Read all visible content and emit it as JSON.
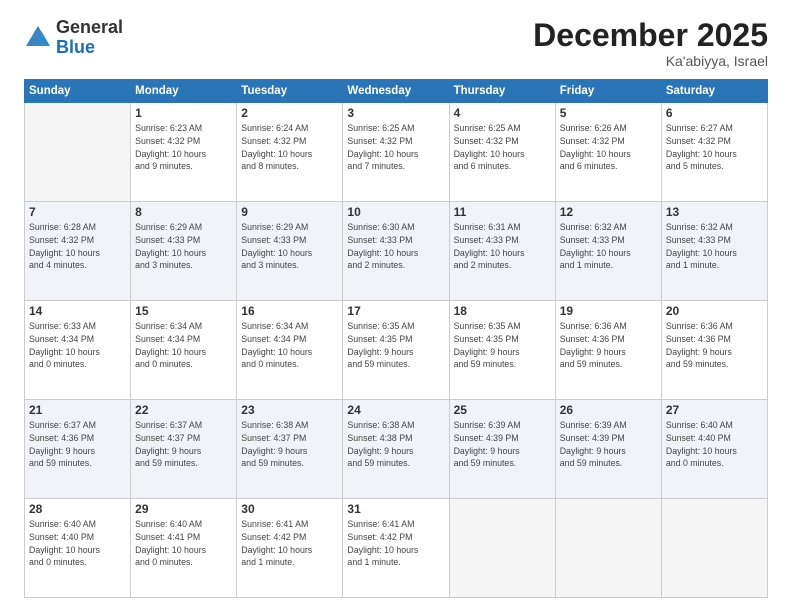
{
  "header": {
    "logo_general": "General",
    "logo_blue": "Blue",
    "month": "December 2025",
    "location": "Ka'abiyya, Israel"
  },
  "days_of_week": [
    "Sunday",
    "Monday",
    "Tuesday",
    "Wednesday",
    "Thursday",
    "Friday",
    "Saturday"
  ],
  "weeks": [
    [
      {
        "num": "",
        "info": ""
      },
      {
        "num": "1",
        "info": "Sunrise: 6:23 AM\nSunset: 4:32 PM\nDaylight: 10 hours\nand 9 minutes."
      },
      {
        "num": "2",
        "info": "Sunrise: 6:24 AM\nSunset: 4:32 PM\nDaylight: 10 hours\nand 8 minutes."
      },
      {
        "num": "3",
        "info": "Sunrise: 6:25 AM\nSunset: 4:32 PM\nDaylight: 10 hours\nand 7 minutes."
      },
      {
        "num": "4",
        "info": "Sunrise: 6:25 AM\nSunset: 4:32 PM\nDaylight: 10 hours\nand 6 minutes."
      },
      {
        "num": "5",
        "info": "Sunrise: 6:26 AM\nSunset: 4:32 PM\nDaylight: 10 hours\nand 6 minutes."
      },
      {
        "num": "6",
        "info": "Sunrise: 6:27 AM\nSunset: 4:32 PM\nDaylight: 10 hours\nand 5 minutes."
      }
    ],
    [
      {
        "num": "7",
        "info": "Sunrise: 6:28 AM\nSunset: 4:32 PM\nDaylight: 10 hours\nand 4 minutes."
      },
      {
        "num": "8",
        "info": "Sunrise: 6:29 AM\nSunset: 4:33 PM\nDaylight: 10 hours\nand 3 minutes."
      },
      {
        "num": "9",
        "info": "Sunrise: 6:29 AM\nSunset: 4:33 PM\nDaylight: 10 hours\nand 3 minutes."
      },
      {
        "num": "10",
        "info": "Sunrise: 6:30 AM\nSunset: 4:33 PM\nDaylight: 10 hours\nand 2 minutes."
      },
      {
        "num": "11",
        "info": "Sunrise: 6:31 AM\nSunset: 4:33 PM\nDaylight: 10 hours\nand 2 minutes."
      },
      {
        "num": "12",
        "info": "Sunrise: 6:32 AM\nSunset: 4:33 PM\nDaylight: 10 hours\nand 1 minute."
      },
      {
        "num": "13",
        "info": "Sunrise: 6:32 AM\nSunset: 4:33 PM\nDaylight: 10 hours\nand 1 minute."
      }
    ],
    [
      {
        "num": "14",
        "info": "Sunrise: 6:33 AM\nSunset: 4:34 PM\nDaylight: 10 hours\nand 0 minutes."
      },
      {
        "num": "15",
        "info": "Sunrise: 6:34 AM\nSunset: 4:34 PM\nDaylight: 10 hours\nand 0 minutes."
      },
      {
        "num": "16",
        "info": "Sunrise: 6:34 AM\nSunset: 4:34 PM\nDaylight: 10 hours\nand 0 minutes."
      },
      {
        "num": "17",
        "info": "Sunrise: 6:35 AM\nSunset: 4:35 PM\nDaylight: 9 hours\nand 59 minutes."
      },
      {
        "num": "18",
        "info": "Sunrise: 6:35 AM\nSunset: 4:35 PM\nDaylight: 9 hours\nand 59 minutes."
      },
      {
        "num": "19",
        "info": "Sunrise: 6:36 AM\nSunset: 4:36 PM\nDaylight: 9 hours\nand 59 minutes."
      },
      {
        "num": "20",
        "info": "Sunrise: 6:36 AM\nSunset: 4:36 PM\nDaylight: 9 hours\nand 59 minutes."
      }
    ],
    [
      {
        "num": "21",
        "info": "Sunrise: 6:37 AM\nSunset: 4:36 PM\nDaylight: 9 hours\nand 59 minutes."
      },
      {
        "num": "22",
        "info": "Sunrise: 6:37 AM\nSunset: 4:37 PM\nDaylight: 9 hours\nand 59 minutes."
      },
      {
        "num": "23",
        "info": "Sunrise: 6:38 AM\nSunset: 4:37 PM\nDaylight: 9 hours\nand 59 minutes."
      },
      {
        "num": "24",
        "info": "Sunrise: 6:38 AM\nSunset: 4:38 PM\nDaylight: 9 hours\nand 59 minutes."
      },
      {
        "num": "25",
        "info": "Sunrise: 6:39 AM\nSunset: 4:39 PM\nDaylight: 9 hours\nand 59 minutes."
      },
      {
        "num": "26",
        "info": "Sunrise: 6:39 AM\nSunset: 4:39 PM\nDaylight: 9 hours\nand 59 minutes."
      },
      {
        "num": "27",
        "info": "Sunrise: 6:40 AM\nSunset: 4:40 PM\nDaylight: 10 hours\nand 0 minutes."
      }
    ],
    [
      {
        "num": "28",
        "info": "Sunrise: 6:40 AM\nSunset: 4:40 PM\nDaylight: 10 hours\nand 0 minutes."
      },
      {
        "num": "29",
        "info": "Sunrise: 6:40 AM\nSunset: 4:41 PM\nDaylight: 10 hours\nand 0 minutes."
      },
      {
        "num": "30",
        "info": "Sunrise: 6:41 AM\nSunset: 4:42 PM\nDaylight: 10 hours\nand 1 minute."
      },
      {
        "num": "31",
        "info": "Sunrise: 6:41 AM\nSunset: 4:42 PM\nDaylight: 10 hours\nand 1 minute."
      },
      {
        "num": "",
        "info": ""
      },
      {
        "num": "",
        "info": ""
      },
      {
        "num": "",
        "info": ""
      }
    ]
  ]
}
